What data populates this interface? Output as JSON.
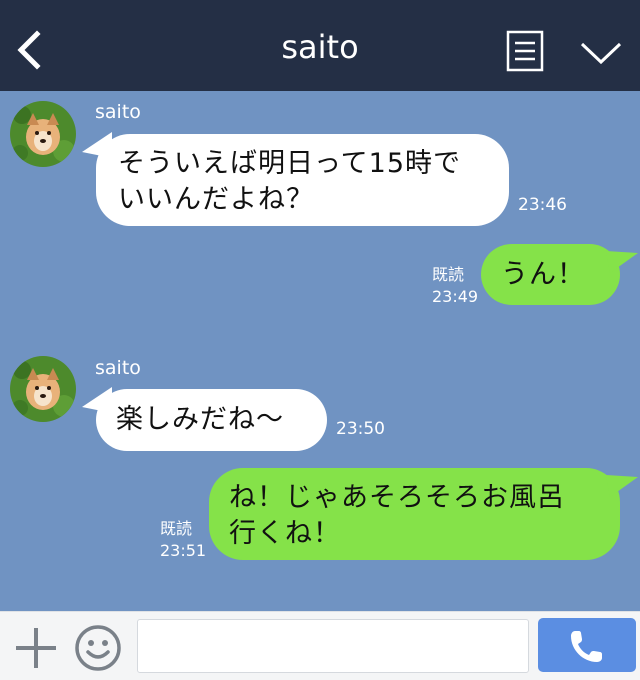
{
  "header": {
    "title": "saito",
    "back_icon": "chevron-left-icon",
    "menu_icon": "list-icon",
    "expand_icon": "chevron-down-icon"
  },
  "messages": [
    {
      "side": "left",
      "sender": "saito",
      "lines": [
        "そういえば明日って15時で",
        "いいんだよね？"
      ],
      "time": "23:46"
    },
    {
      "side": "right",
      "read": "既読",
      "lines": [
        "うん！"
      ],
      "time": "23:49"
    },
    {
      "side": "left",
      "sender": "saito",
      "lines": [
        "楽しみだね〜"
      ],
      "time": "23:50"
    },
    {
      "side": "right",
      "read": "既読",
      "lines": [
        "ね！じゃあそろそろお風呂",
        "行くね！"
      ],
      "time": "23:51"
    }
  ],
  "footer": {
    "plus_icon": "plus-icon",
    "emoji_icon": "smiley-icon",
    "input_value": "",
    "call_icon": "phone-icon"
  },
  "colors": {
    "header_bg": "#242f45",
    "chat_bg": "#7093c2",
    "bubble_incoming": "#ffffff",
    "bubble_outgoing": "#85e249",
    "call_button": "#5b8ee2"
  }
}
